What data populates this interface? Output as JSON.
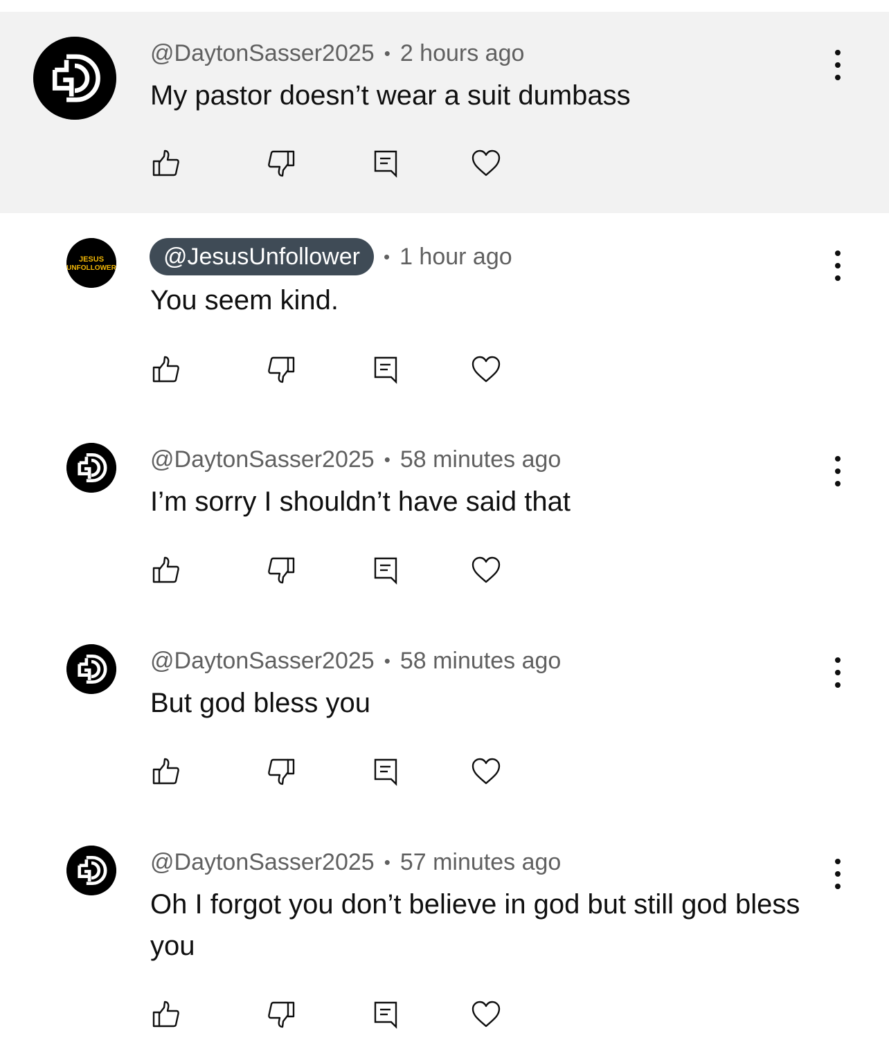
{
  "comments": [
    {
      "handle": "@DaytonSasser2025",
      "time": "2 hours ago",
      "separator": "•",
      "text": "My pastor doesn’t wear a suit dumbass",
      "avatar": "ds-logo-icon",
      "highlighted": true
    },
    {
      "handle": "@JesusUnfollower",
      "time": "1 hour ago",
      "separator": "•",
      "text": "You seem kind.",
      "avatar": "jesus-unfollower-logo",
      "avatar_text": [
        "JESUS",
        "UNFOLLOWER"
      ],
      "handle_pill": true
    },
    {
      "handle": "@DaytonSasser2025",
      "time": "58 minutes ago",
      "separator": "•",
      "text": "I’m sorry I shouldn’t have said that",
      "avatar": "ds-logo-icon"
    },
    {
      "handle": "@DaytonSasser2025",
      "time": "58 minutes ago",
      "separator": "•",
      "text": "But god bless you",
      "avatar": "ds-logo-icon"
    },
    {
      "handle": "@DaytonSasser2025",
      "time": "57 minutes ago",
      "separator": "•",
      "text": "Oh I forgot you don’t believe in god but still god bless you",
      "avatar": "ds-logo-icon"
    }
  ],
  "actions": [
    "thumbs-up-icon",
    "thumbs-down-icon",
    "reply-icon",
    "heart-icon"
  ],
  "colors": {
    "highlight_bg": "#f2f2f2",
    "meta_text": "#606060",
    "pill_bg": "#3f4b56",
    "text": "#0f0f0f"
  }
}
